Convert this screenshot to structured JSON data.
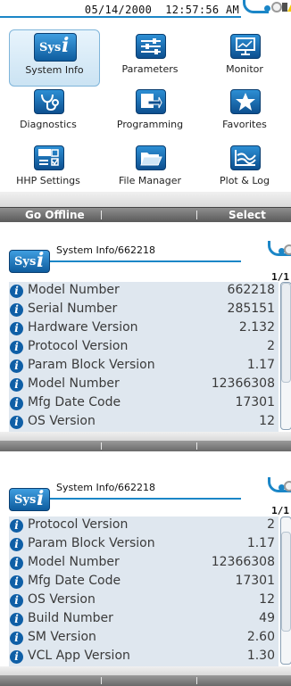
{
  "main_menu": {
    "datetime": "05/14/2000  12:57:56 AM",
    "tiles": [
      {
        "label": "System Info",
        "icon": "sys-info-icon"
      },
      {
        "label": "Parameters",
        "icon": "parameters-icon"
      },
      {
        "label": "Monitor",
        "icon": "monitor-icon"
      },
      {
        "label": "Diagnostics",
        "icon": "diagnostics-icon"
      },
      {
        "label": "Programming",
        "icon": "programming-icon"
      },
      {
        "label": "Favorites",
        "icon": "favorites-icon"
      },
      {
        "label": "HHP Settings",
        "icon": "hhp-settings-icon"
      },
      {
        "label": "File Manager",
        "icon": "file-manager-icon"
      },
      {
        "label": "Plot & Log",
        "icon": "plot-log-icon"
      }
    ],
    "sys_logo_s": "Sys",
    "sys_logo_i": "i",
    "softkeys": {
      "left": "Go Offline",
      "right": "Select"
    }
  },
  "detail_1": {
    "title": "System Info/662218",
    "page": "1/1",
    "rows": [
      {
        "name": "Model Number",
        "value": "662218"
      },
      {
        "name": "Serial Number",
        "value": "285151"
      },
      {
        "name": "Hardware Version",
        "value": "2.132"
      },
      {
        "name": "Protocol Version",
        "value": "2"
      },
      {
        "name": "Param Block Version",
        "value": "1.17"
      },
      {
        "name": "Model Number",
        "value": "12366308"
      },
      {
        "name": "Mfg Date Code",
        "value": "17301"
      },
      {
        "name": "OS Version",
        "value": "12"
      }
    ],
    "scroll_position": 0.0
  },
  "detail_2": {
    "title": "System Info/662218",
    "page": "1/1",
    "rows": [
      {
        "name": "Protocol Version",
        "value": "2"
      },
      {
        "name": "Param Block Version",
        "value": "1.17"
      },
      {
        "name": "Model Number",
        "value": "12366308"
      },
      {
        "name": "Mfg Date Code",
        "value": "17301"
      },
      {
        "name": "OS Version",
        "value": "12"
      },
      {
        "name": "Build Number",
        "value": "49"
      },
      {
        "name": "SM Version",
        "value": "2.60"
      },
      {
        "name": "VCL App Version",
        "value": "1.30"
      }
    ],
    "scroll_position": 0.3
  },
  "info_glyph": "i",
  "colors": {
    "accent": "#1b86c7",
    "icon_blue": "#0e5c9e",
    "list_bg": "#dfe7ef",
    "softkey_bar": "#6e6e6e"
  }
}
